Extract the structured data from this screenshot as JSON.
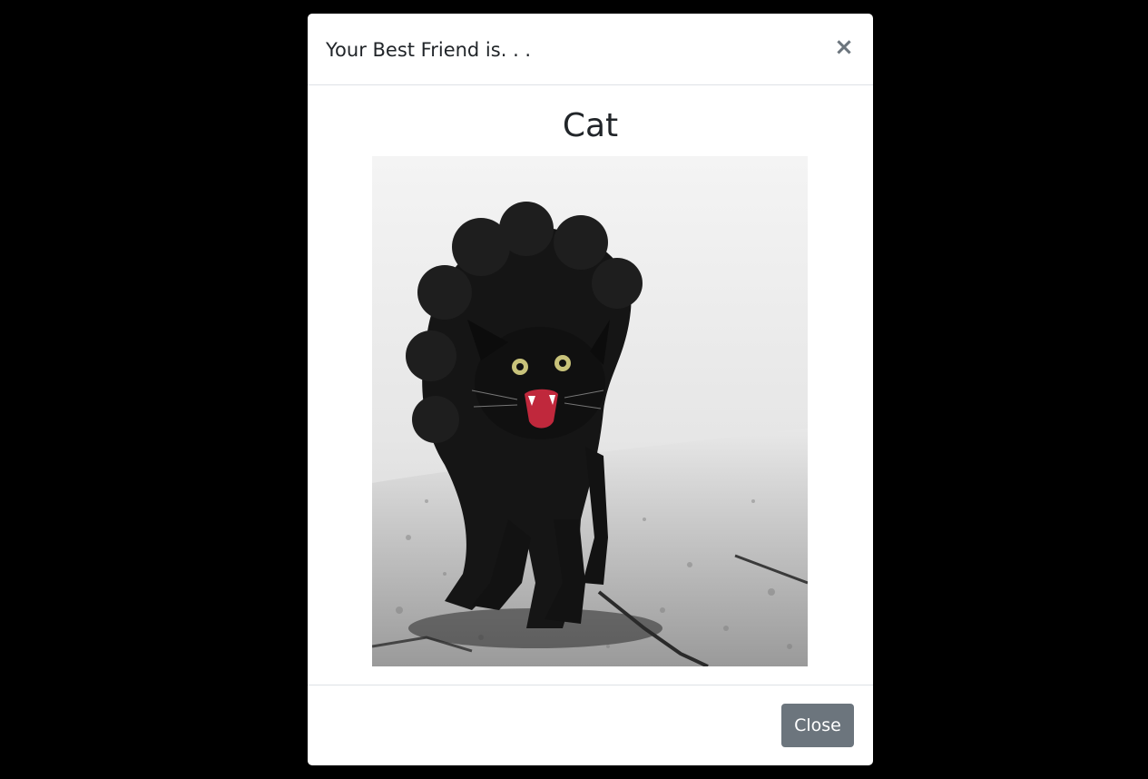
{
  "modal": {
    "title": "Your Best Friend is. . .",
    "close_icon": "close-icon",
    "close_glyph": "×"
  },
  "result": {
    "title": "Cat",
    "image": "hissing-black-cat-photo"
  },
  "footer": {
    "close_label": "Close"
  },
  "colors": {
    "backdrop": "#000000",
    "modal_bg": "#ffffff",
    "text": "#212529",
    "secondary_button": "#6c757d",
    "divider": "#dee2e6"
  }
}
